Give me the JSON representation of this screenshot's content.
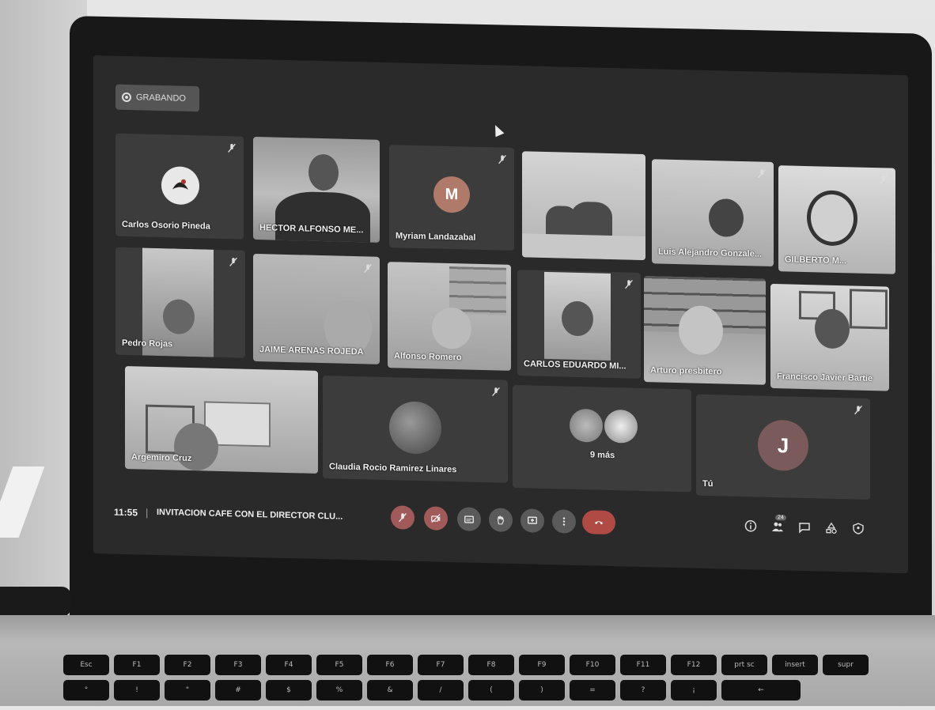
{
  "recording": {
    "label": "GRABANDO"
  },
  "meeting": {
    "time": "11:55",
    "separator": "|",
    "title": "INVITACION CAFE CON EL DIRECTOR CLU..."
  },
  "participants_count": "24",
  "tiles": [
    {
      "name": "Carlos Osorio Pineda"
    },
    {
      "name": "HECTOR ALFONSO ME..."
    },
    {
      "name": "Myriam Landazabal",
      "initial": "M"
    },
    {
      "name": ""
    },
    {
      "name": "Luis Alejandro Gonzale..."
    },
    {
      "name": "GILBERTO M..."
    },
    {
      "name": "Pedro Rojas"
    },
    {
      "name": "JAIME ARENAS ROJEDA"
    },
    {
      "name": "Alfonso Romero"
    },
    {
      "name": "CARLOS EDUARDO MI..."
    },
    {
      "name": "Arturo presbitero"
    },
    {
      "name": "Francisco Javier Bartie"
    },
    {
      "name": "Argemiro Cruz"
    },
    {
      "name": "Claudia Rocio Ramirez Linares"
    },
    {
      "name": "9 más"
    },
    {
      "name": "Tú",
      "initial": "J"
    }
  ],
  "colors": {
    "end_call": "#b04a44",
    "mic_off": "#a05a5a",
    "avatar_m": "#b07a6a",
    "avatar_j": "#7a5a5a"
  },
  "keyboard": {
    "row1": [
      "Esc",
      "F1",
      "F2",
      "F3",
      "F4",
      "F5",
      "F6",
      "F7",
      "F8",
      "F9",
      "F10",
      "F11",
      "F12",
      "prt sc",
      "insert",
      "supr"
    ],
    "row2": [
      "°",
      "!",
      "\"",
      "#",
      "$",
      "%",
      "&",
      "/",
      "(",
      ")",
      "=",
      "?",
      "¡",
      "←"
    ]
  }
}
